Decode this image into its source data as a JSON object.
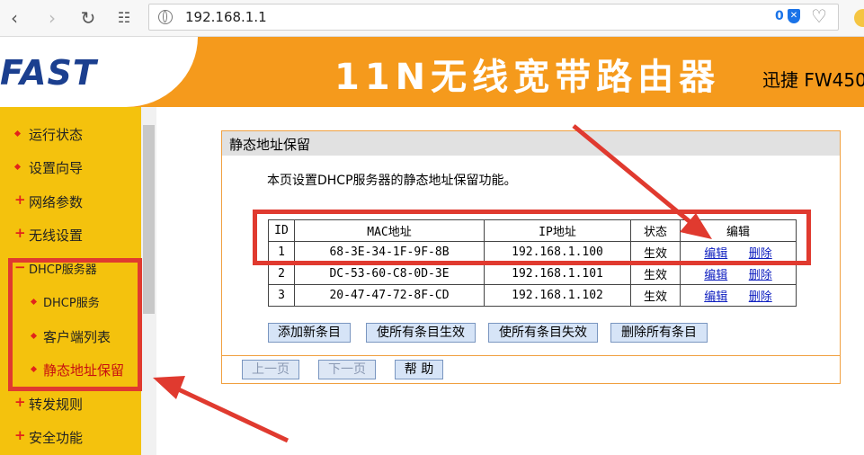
{
  "browser": {
    "url": "192.168.1.1",
    "shield_count": "0"
  },
  "header": {
    "logo": "FAST",
    "title": "11N无线宽带路由器",
    "model": "迅捷 FW450"
  },
  "sidebar": {
    "items": [
      {
        "label": "运行状态",
        "marker": "bullet"
      },
      {
        "label": "设置向导",
        "marker": "bullet"
      },
      {
        "label": "网络参数",
        "marker": "plus"
      },
      {
        "label": "无线设置",
        "marker": "plus"
      },
      {
        "label": "DHCP服务器",
        "marker": "minus"
      },
      {
        "label": "DHCP服务",
        "marker": "bullet"
      },
      {
        "label": "客户端列表",
        "marker": "bullet"
      },
      {
        "label": "静态地址保留",
        "marker": "bullet"
      },
      {
        "label": "转发规则",
        "marker": "plus"
      },
      {
        "label": "安全功能",
        "marker": "plus"
      }
    ]
  },
  "panel": {
    "title": "静态地址保留",
    "description": "本页设置DHCP服务器的静态地址保留功能。",
    "table": {
      "headers": [
        "ID",
        "MAC地址",
        "IP地址",
        "状态",
        "编辑"
      ],
      "rows": [
        {
          "id": "1",
          "mac": "68-3E-34-1F-9F-8B",
          "ip": "192.168.1.100",
          "status": "生效",
          "edit": "编辑",
          "delete": "删除"
        },
        {
          "id": "2",
          "mac": "DC-53-60-C8-0D-3E",
          "ip": "192.168.1.101",
          "status": "生效",
          "edit": "编辑",
          "delete": "删除"
        },
        {
          "id": "3",
          "mac": "20-47-47-72-8F-CD",
          "ip": "192.168.1.102",
          "status": "生效",
          "edit": "编辑",
          "delete": "删除"
        }
      ]
    },
    "actions": {
      "add": "添加新条目",
      "enable_all": "使所有条目生效",
      "disable_all": "使所有条目失效",
      "delete_all": "删除所有条目"
    },
    "pager": {
      "prev": "上一页",
      "next": "下一页",
      "help": "帮 助"
    }
  },
  "colors": {
    "header_orange": "#f59a1c",
    "sidebar_yellow": "#f4c20d",
    "annotation_red": "#e03a2f",
    "logo_blue": "#1b3f8f",
    "link_blue": "#1020c0"
  }
}
